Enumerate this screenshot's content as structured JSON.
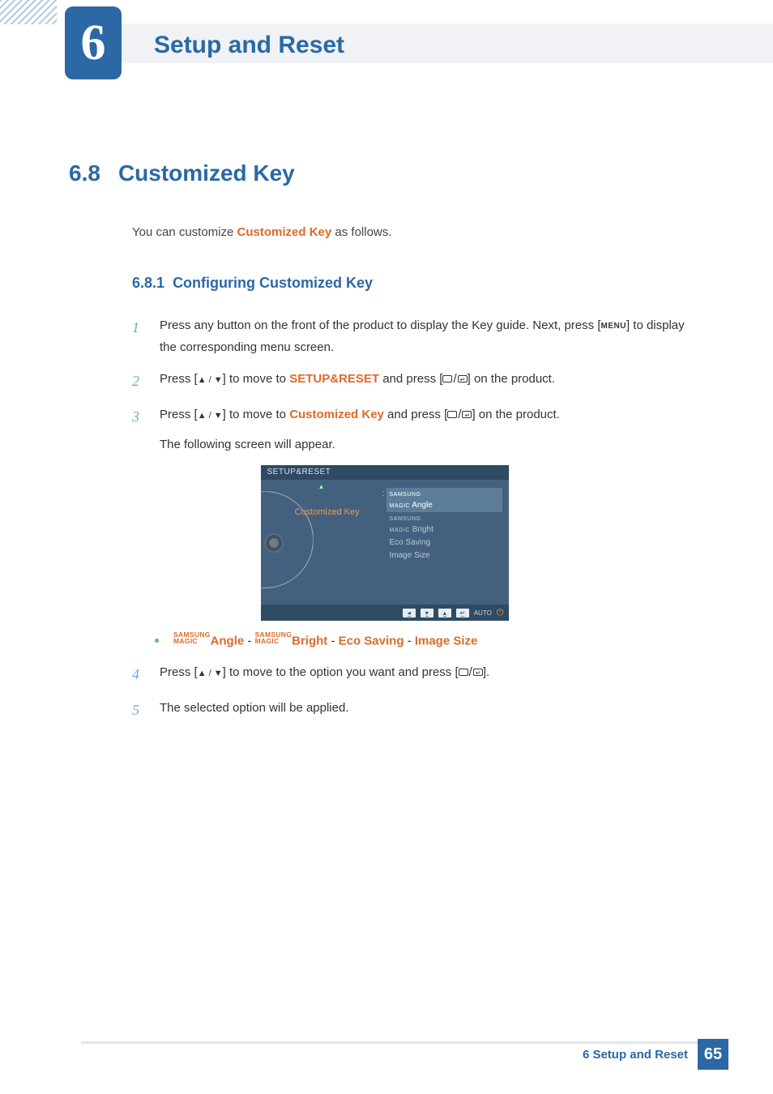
{
  "chapter": {
    "number": "6",
    "title": "Setup and Reset"
  },
  "section": {
    "number": "6.8",
    "title": "Customized Key"
  },
  "intro": {
    "prefix": "You can customize ",
    "highlight": "Customized Key",
    "suffix": " as follows."
  },
  "subsection": {
    "number": "6.8.1",
    "title": "Configuring Customized Key"
  },
  "steps": {
    "s1": {
      "num": "1",
      "a": "Press any button on the front of the product to display the Key guide. Next, press [",
      "menu": "MENU",
      "b": "] to display the corresponding menu screen."
    },
    "s2": {
      "num": "2",
      "a": "Press [",
      "arrows": "▲ / ▼",
      "b": "] to move to ",
      "hl": "SETUP&RESET",
      "c": " and press [",
      "d": "] on the product."
    },
    "s3": {
      "num": "3",
      "a": "Press [",
      "arrows": "▲ / ▼",
      "b": "] to move to ",
      "hl": "Customized Key",
      "c": " and press [",
      "d": "] on the product.",
      "follow": "The following screen will appear."
    },
    "s4": {
      "num": "4",
      "a": "Press [",
      "arrows": "▲ / ▼",
      "b": "] to move to the option you want and press [",
      "c": "]."
    },
    "s5": {
      "num": "5",
      "a": "The selected option will be applied."
    }
  },
  "osd": {
    "title": "SETUP&RESET",
    "item": "Customized Key",
    "options": [
      {
        "magic_top": "SAMSUNG",
        "magic_bottom": "MAGIC",
        "label": "Angle",
        "selected": true
      },
      {
        "magic_top": "SAMSUNG",
        "magic_bottom": "MAGIC",
        "label": "Bright",
        "selected": false
      },
      {
        "label": "Eco Saving",
        "selected": false
      },
      {
        "label": "Image Size",
        "selected": false
      }
    ],
    "footer_auto": "AUTO"
  },
  "options_line": {
    "magic_top": "SAMSUNG",
    "magic_bottom": "MAGIC",
    "opt1": "Angle",
    "sep": " - ",
    "opt2": "Bright",
    "opt3": "Eco Saving",
    "opt4": "Image Size"
  },
  "footer": {
    "label": "6 Setup and Reset",
    "page": "65"
  }
}
